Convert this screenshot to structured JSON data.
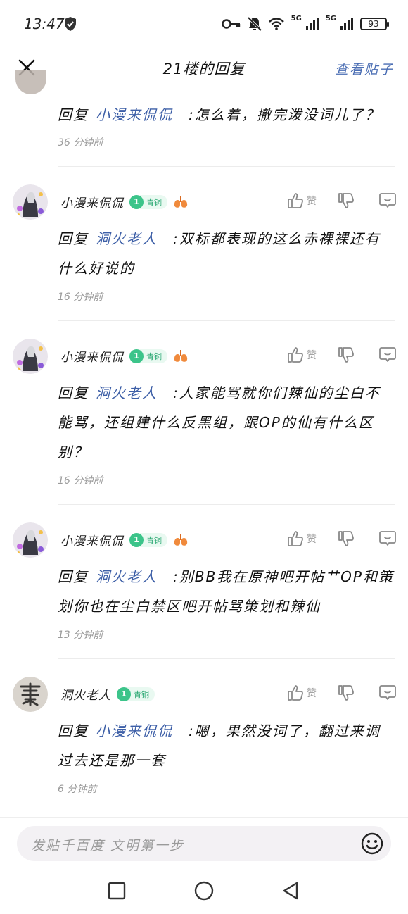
{
  "status": {
    "time": "13:47",
    "net1": "5G",
    "net2": "5G",
    "battery": "93"
  },
  "header": {
    "title": "21楼的回复",
    "view_post": "查看贴子"
  },
  "top_reply": {
    "prefix": "回复",
    "target": "小漫来侃侃",
    "text": ":怎么着，撤完泼没词儿了？",
    "time": "36 分钟前"
  },
  "comments": [
    {
      "username": "小漫来侃侃",
      "level": "1",
      "level_name": "青铜",
      "like_label": "赞",
      "prefix": "回复",
      "target": "洞火老人",
      "text": ":双标都表现的这么赤裸裸还有什么好说的",
      "time": "16 分钟前"
    },
    {
      "username": "小漫来侃侃",
      "level": "1",
      "level_name": "青铜",
      "like_label": "赞",
      "prefix": "回复",
      "target": "洞火老人",
      "text": ":人家能骂就你们辣仙的尘白不能骂，还组建什么反黑组，跟OP的仙有什么区别？",
      "time": "16 分钟前"
    },
    {
      "username": "小漫来侃侃",
      "level": "1",
      "level_name": "青铜",
      "like_label": "赞",
      "prefix": "回复",
      "target": "洞火老人",
      "text": ":别BB我在原神吧开帖艹OP和策划你也在尘白禁区吧开帖骂策划和辣仙",
      "time": "13 分钟前"
    },
    {
      "username": "洞火老人",
      "level": "1",
      "level_name": "青铜",
      "like_label": "赞",
      "prefix": "回复",
      "target": "小漫来侃侃",
      "text": ":嗯，果然没词了，翻过来调过去还是那一套",
      "time": "6 分钟前"
    }
  ],
  "input": {
    "placeholder": "发贴千百度 文明第一步"
  },
  "colors": {
    "link": "#3d5fa7",
    "level_badge": "#3cc48a",
    "muted": "#9a9a9a"
  }
}
